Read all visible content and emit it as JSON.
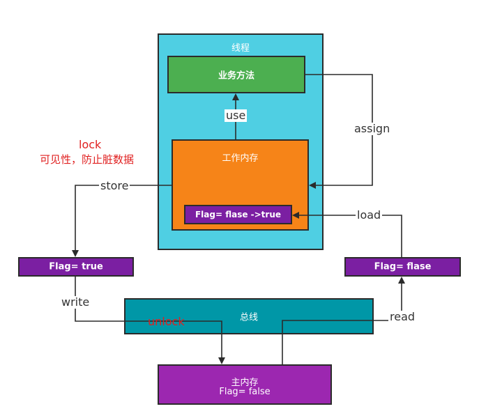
{
  "thread": {
    "title": "线程",
    "color": "#4fcfe3"
  },
  "business": {
    "label": "业务方法",
    "color": "#4caf50"
  },
  "work_memory": {
    "label": "工作内存",
    "color": "#f68418"
  },
  "flag_inner": {
    "label": "Flag= flase ->true",
    "color": "#7b1fa2"
  },
  "flag_left": {
    "label": "Flag= true",
    "color": "#7b1fa2"
  },
  "flag_right": {
    "label": "Flag= flase",
    "color": "#7b1fa2"
  },
  "bus": {
    "label": "总线",
    "color": "#0097a7"
  },
  "main_memory": {
    "title": "主内存",
    "value": "Flag= false",
    "color": "#9c27b0"
  },
  "edges": {
    "use": "use",
    "assign": "assign",
    "store": "store",
    "load": "load",
    "write": "write",
    "read": "read",
    "unlock": "unlock"
  },
  "note": {
    "lock": "lock",
    "desc": "可见性，防止脏数据"
  }
}
